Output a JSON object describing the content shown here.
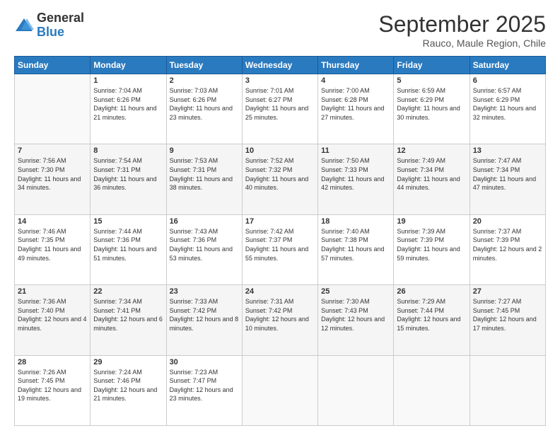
{
  "logo": {
    "general": "General",
    "blue": "Blue"
  },
  "header": {
    "month": "September 2025",
    "location": "Rauco, Maule Region, Chile"
  },
  "days_of_week": [
    "Sunday",
    "Monday",
    "Tuesday",
    "Wednesday",
    "Thursday",
    "Friday",
    "Saturday"
  ],
  "weeks": [
    [
      {
        "day": "",
        "info": ""
      },
      {
        "day": "1",
        "info": "Sunrise: 7:04 AM\nSunset: 6:26 PM\nDaylight: 11 hours\nand 21 minutes."
      },
      {
        "day": "2",
        "info": "Sunrise: 7:03 AM\nSunset: 6:26 PM\nDaylight: 11 hours\nand 23 minutes."
      },
      {
        "day": "3",
        "info": "Sunrise: 7:01 AM\nSunset: 6:27 PM\nDaylight: 11 hours\nand 25 minutes."
      },
      {
        "day": "4",
        "info": "Sunrise: 7:00 AM\nSunset: 6:28 PM\nDaylight: 11 hours\nand 27 minutes."
      },
      {
        "day": "5",
        "info": "Sunrise: 6:59 AM\nSunset: 6:29 PM\nDaylight: 11 hours\nand 30 minutes."
      },
      {
        "day": "6",
        "info": "Sunrise: 6:57 AM\nSunset: 6:29 PM\nDaylight: 11 hours\nand 32 minutes."
      }
    ],
    [
      {
        "day": "7",
        "info": "Sunrise: 7:56 AM\nSunset: 7:30 PM\nDaylight: 11 hours\nand 34 minutes."
      },
      {
        "day": "8",
        "info": "Sunrise: 7:54 AM\nSunset: 7:31 PM\nDaylight: 11 hours\nand 36 minutes."
      },
      {
        "day": "9",
        "info": "Sunrise: 7:53 AM\nSunset: 7:31 PM\nDaylight: 11 hours\nand 38 minutes."
      },
      {
        "day": "10",
        "info": "Sunrise: 7:52 AM\nSunset: 7:32 PM\nDaylight: 11 hours\nand 40 minutes."
      },
      {
        "day": "11",
        "info": "Sunrise: 7:50 AM\nSunset: 7:33 PM\nDaylight: 11 hours\nand 42 minutes."
      },
      {
        "day": "12",
        "info": "Sunrise: 7:49 AM\nSunset: 7:34 PM\nDaylight: 11 hours\nand 44 minutes."
      },
      {
        "day": "13",
        "info": "Sunrise: 7:47 AM\nSunset: 7:34 PM\nDaylight: 11 hours\nand 47 minutes."
      }
    ],
    [
      {
        "day": "14",
        "info": "Sunrise: 7:46 AM\nSunset: 7:35 PM\nDaylight: 11 hours\nand 49 minutes."
      },
      {
        "day": "15",
        "info": "Sunrise: 7:44 AM\nSunset: 7:36 PM\nDaylight: 11 hours\nand 51 minutes."
      },
      {
        "day": "16",
        "info": "Sunrise: 7:43 AM\nSunset: 7:36 PM\nDaylight: 11 hours\nand 53 minutes."
      },
      {
        "day": "17",
        "info": "Sunrise: 7:42 AM\nSunset: 7:37 PM\nDaylight: 11 hours\nand 55 minutes."
      },
      {
        "day": "18",
        "info": "Sunrise: 7:40 AM\nSunset: 7:38 PM\nDaylight: 11 hours\nand 57 minutes."
      },
      {
        "day": "19",
        "info": "Sunrise: 7:39 AM\nSunset: 7:39 PM\nDaylight: 11 hours\nand 59 minutes."
      },
      {
        "day": "20",
        "info": "Sunrise: 7:37 AM\nSunset: 7:39 PM\nDaylight: 12 hours\nand 2 minutes."
      }
    ],
    [
      {
        "day": "21",
        "info": "Sunrise: 7:36 AM\nSunset: 7:40 PM\nDaylight: 12 hours\nand 4 minutes."
      },
      {
        "day": "22",
        "info": "Sunrise: 7:34 AM\nSunset: 7:41 PM\nDaylight: 12 hours\nand 6 minutes."
      },
      {
        "day": "23",
        "info": "Sunrise: 7:33 AM\nSunset: 7:42 PM\nDaylight: 12 hours\nand 8 minutes."
      },
      {
        "day": "24",
        "info": "Sunrise: 7:31 AM\nSunset: 7:42 PM\nDaylight: 12 hours\nand 10 minutes."
      },
      {
        "day": "25",
        "info": "Sunrise: 7:30 AM\nSunset: 7:43 PM\nDaylight: 12 hours\nand 12 minutes."
      },
      {
        "day": "26",
        "info": "Sunrise: 7:29 AM\nSunset: 7:44 PM\nDaylight: 12 hours\nand 15 minutes."
      },
      {
        "day": "27",
        "info": "Sunrise: 7:27 AM\nSunset: 7:45 PM\nDaylight: 12 hours\nand 17 minutes."
      }
    ],
    [
      {
        "day": "28",
        "info": "Sunrise: 7:26 AM\nSunset: 7:45 PM\nDaylight: 12 hours\nand 19 minutes."
      },
      {
        "day": "29",
        "info": "Sunrise: 7:24 AM\nSunset: 7:46 PM\nDaylight: 12 hours\nand 21 minutes."
      },
      {
        "day": "30",
        "info": "Sunrise: 7:23 AM\nSunset: 7:47 PM\nDaylight: 12 hours\nand 23 minutes."
      },
      {
        "day": "",
        "info": ""
      },
      {
        "day": "",
        "info": ""
      },
      {
        "day": "",
        "info": ""
      },
      {
        "day": "",
        "info": ""
      }
    ]
  ]
}
